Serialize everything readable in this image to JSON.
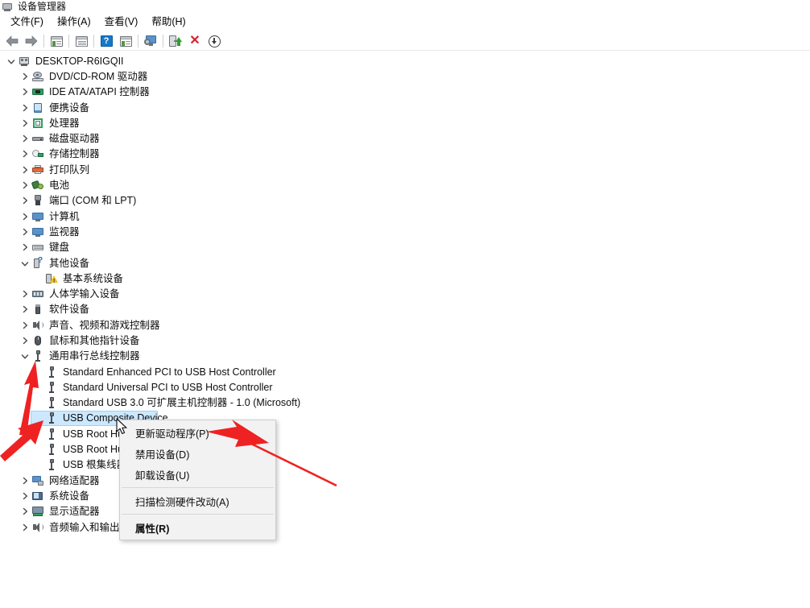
{
  "window": {
    "title": "设备管理器",
    "icon": "device-manager-icon"
  },
  "menubar": {
    "items": [
      {
        "label": "文件(F)",
        "name": "menu-file"
      },
      {
        "label": "操作(A)",
        "name": "menu-action"
      },
      {
        "label": "查看(V)",
        "name": "menu-view"
      },
      {
        "label": "帮助(H)",
        "name": "menu-help"
      }
    ]
  },
  "toolbar": {
    "buttons": [
      {
        "icon": "back-arrow-icon",
        "name": "toolbar-back"
      },
      {
        "icon": "forward-arrow-icon",
        "name": "toolbar-forward"
      },
      {
        "icon": "show-hidden-devices-icon",
        "name": "toolbar-show-hidden"
      },
      {
        "icon": "properties-icon",
        "name": "toolbar-properties"
      },
      {
        "icon": "help-icon",
        "name": "toolbar-help"
      },
      {
        "icon": "update-view-icon",
        "name": "toolbar-update-view"
      },
      {
        "icon": "scan-hardware-icon",
        "name": "toolbar-scan-hardware"
      },
      {
        "icon": "update-driver-icon",
        "name": "toolbar-update-driver"
      },
      {
        "icon": "uninstall-device-icon",
        "name": "toolbar-uninstall"
      },
      {
        "icon": "disable-device-icon",
        "name": "toolbar-disable"
      }
    ]
  },
  "tree": {
    "root": {
      "label": "DESKTOP-R6IGQII",
      "icon": "computer-icon",
      "expanded": true,
      "indent": 0
    },
    "nodes": [
      {
        "label": "DVD/CD-ROM 驱动器",
        "icon": "dvd-icon",
        "indent": 1,
        "chevron": "collapsed"
      },
      {
        "label": "IDE ATA/ATAPI 控制器",
        "icon": "ide-controller-icon",
        "indent": 1,
        "chevron": "collapsed"
      },
      {
        "label": "便携设备",
        "icon": "portable-device-icon",
        "indent": 1,
        "chevron": "collapsed"
      },
      {
        "label": "处理器",
        "icon": "processor-icon",
        "indent": 1,
        "chevron": "collapsed"
      },
      {
        "label": "磁盘驱动器",
        "icon": "disk-drive-icon",
        "indent": 1,
        "chevron": "collapsed"
      },
      {
        "label": "存储控制器",
        "icon": "storage-controller-icon",
        "indent": 1,
        "chevron": "collapsed"
      },
      {
        "label": "打印队列",
        "icon": "print-queue-icon",
        "indent": 1,
        "chevron": "collapsed"
      },
      {
        "label": "电池",
        "icon": "battery-icon",
        "indent": 1,
        "chevron": "collapsed"
      },
      {
        "label": "端口 (COM 和 LPT)",
        "icon": "port-icon",
        "indent": 1,
        "chevron": "collapsed"
      },
      {
        "label": "计算机",
        "icon": "computer-node-icon",
        "indent": 1,
        "chevron": "collapsed"
      },
      {
        "label": "监视器",
        "icon": "monitor-icon",
        "indent": 1,
        "chevron": "collapsed"
      },
      {
        "label": "键盘",
        "icon": "keyboard-icon",
        "indent": 1,
        "chevron": "collapsed"
      },
      {
        "label": "其他设备",
        "icon": "unknown-device-icon",
        "indent": 1,
        "chevron": "expanded"
      },
      {
        "label": "基本系统设备",
        "icon": "warning-device-icon",
        "indent": 2,
        "chevron": "none"
      },
      {
        "label": "人体学输入设备",
        "icon": "hid-icon",
        "indent": 1,
        "chevron": "collapsed"
      },
      {
        "label": "软件设备",
        "icon": "software-device-icon",
        "indent": 1,
        "chevron": "collapsed"
      },
      {
        "label": "声音、视频和游戏控制器",
        "icon": "sound-icon",
        "indent": 1,
        "chevron": "collapsed"
      },
      {
        "label": "鼠标和其他指针设备",
        "icon": "mouse-icon",
        "indent": 1,
        "chevron": "collapsed"
      },
      {
        "label": "通用串行总线控制器",
        "icon": "usb-icon",
        "indent": 1,
        "chevron": "expanded"
      },
      {
        "label": "Standard Enhanced PCI to USB Host Controller",
        "icon": "usb-icon",
        "indent": 2,
        "chevron": "none"
      },
      {
        "label": "Standard Universal PCI to USB Host Controller",
        "icon": "usb-icon",
        "indent": 2,
        "chevron": "none"
      },
      {
        "label": "Standard USB 3.0 可扩展主机控制器 - 1.0 (Microsoft)",
        "icon": "usb-icon",
        "indent": 2,
        "chevron": "none"
      },
      {
        "label": "USB Composite Device",
        "icon": "usb-icon",
        "indent": 2,
        "chevron": "none",
        "selected": true
      },
      {
        "label": "USB Root Hub",
        "icon": "usb-icon",
        "indent": 2,
        "chevron": "none"
      },
      {
        "label": "USB Root Hub",
        "icon": "usb-icon",
        "indent": 2,
        "chevron": "none"
      },
      {
        "label": "USB 根集线器",
        "icon": "usb-icon",
        "indent": 2,
        "chevron": "none"
      },
      {
        "label": "网络适配器",
        "icon": "network-adapter-icon",
        "indent": 1,
        "chevron": "collapsed"
      },
      {
        "label": "系统设备",
        "icon": "system-device-icon",
        "indent": 1,
        "chevron": "collapsed"
      },
      {
        "label": "显示适配器",
        "icon": "display-adapter-icon",
        "indent": 1,
        "chevron": "collapsed"
      },
      {
        "label": "音频输入和输出",
        "icon": "audio-io-icon",
        "indent": 1,
        "chevron": "collapsed"
      }
    ]
  },
  "context_menu": {
    "items": [
      {
        "label": "更新驱动程序(P)",
        "name": "ctx-update-driver",
        "type": "item",
        "bold": false
      },
      {
        "label": "禁用设备(D)",
        "name": "ctx-disable-device",
        "type": "item",
        "bold": false
      },
      {
        "label": "卸载设备(U)",
        "name": "ctx-uninstall-device",
        "type": "item",
        "bold": false
      },
      {
        "type": "separator"
      },
      {
        "label": "扫描检测硬件改动(A)",
        "name": "ctx-scan-hardware",
        "type": "item",
        "bold": false
      },
      {
        "type": "separator"
      },
      {
        "label": "属性(R)",
        "name": "ctx-properties",
        "type": "item",
        "bold": true
      }
    ]
  },
  "annotations": {
    "arrow_color": "#ee2222",
    "arrows": [
      {
        "name": "annotation-arrow-usb-group",
        "target": "通用串行总线控制器"
      },
      {
        "name": "annotation-arrow-usb-composite",
        "target": "USB Composite Device"
      },
      {
        "name": "annotation-arrow-update-driver",
        "target": "更新驱动程序(P)"
      }
    ]
  },
  "colors": {
    "selection_bg": "#cce8ff",
    "selection_border": "#99d1ff",
    "menu_bg": "#f2f2f2",
    "window_bg": "#ffffff",
    "text": "#0d0d0d"
  }
}
